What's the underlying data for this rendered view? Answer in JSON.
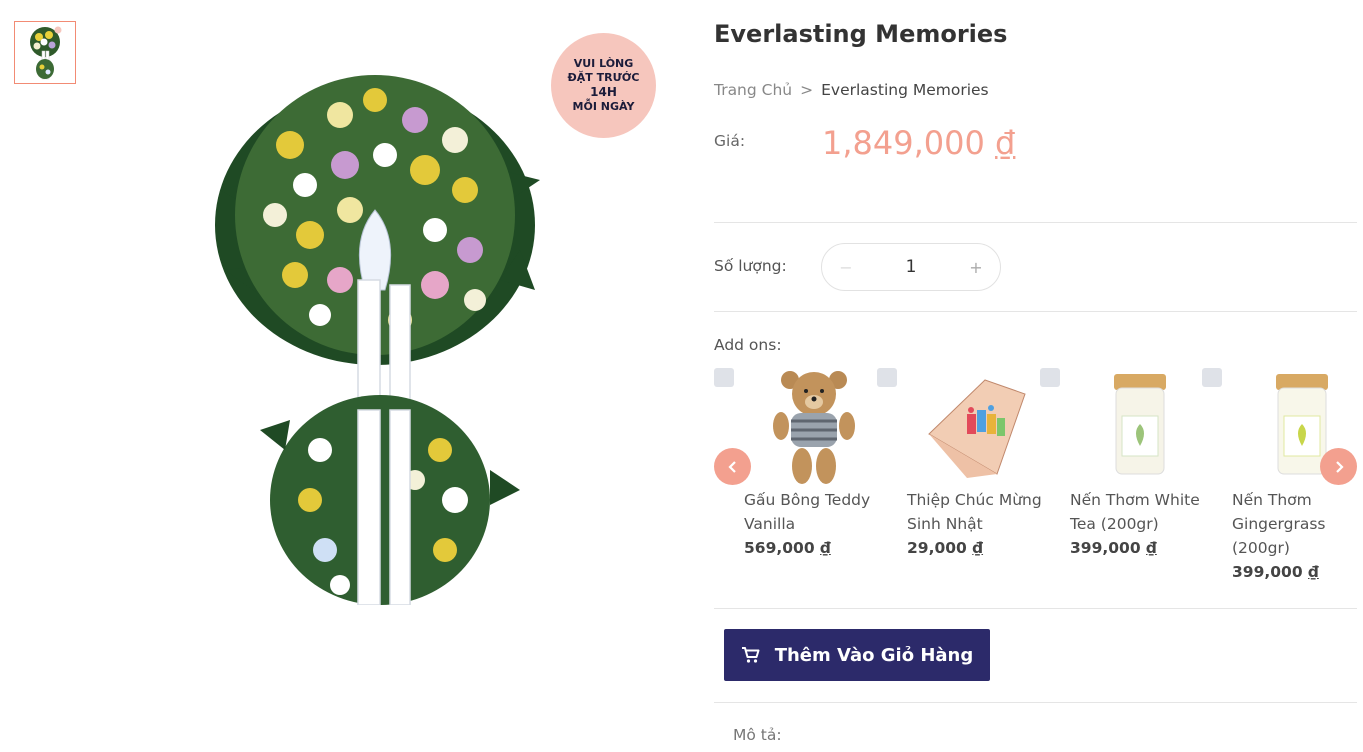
{
  "product": {
    "title": "Everlasting Memories",
    "badge": {
      "line1": "VUI LÒNG",
      "line2": "ĐẶT TRƯỚC",
      "line3": "14H",
      "line4": "MỖI NGÀY"
    }
  },
  "breadcrumb": {
    "home": "Trang Chủ",
    "separator": ">",
    "current": "Everlasting Memories"
  },
  "price": {
    "label": "Giá:",
    "amount": "1,849,000",
    "currency": "₫"
  },
  "quantity": {
    "label": "Số lượng:",
    "minus": "−",
    "value": "1",
    "plus": "+"
  },
  "addons": {
    "label": "Add ons:",
    "items": [
      {
        "name": "Gấu Bông Teddy Vanilla",
        "price": "569,000",
        "currency": "₫"
      },
      {
        "name": "Thiệp Chúc Mừng Sinh Nhật",
        "price": "29,000",
        "currency": "₫"
      },
      {
        "name": "Nến Thơm White Tea (200gr)",
        "price": "399,000",
        "currency": "₫"
      },
      {
        "name": "Nến Thơm Gingergrass (200gr)",
        "price": "399,000",
        "currency": "₫"
      }
    ]
  },
  "cart_button": {
    "label": "Thêm Vào Giỏ Hàng",
    "icon": "cart-icon"
  },
  "description": {
    "label": "Mô tả:"
  },
  "colors": {
    "accent": "#f3a08f",
    "primary": "#2c2a6a",
    "thumb_border": "#f28b74"
  }
}
